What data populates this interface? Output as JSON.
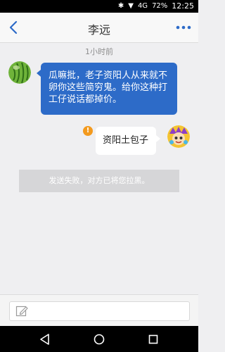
{
  "status_bar": {
    "network": "4G",
    "battery": "72%",
    "time": "12:25"
  },
  "header": {
    "title": "李远"
  },
  "chat": {
    "timestamp": "1小时前",
    "incoming_message": "瓜嘛批，老子资阳人从来就不卵你这些简穷鬼。给你这种打工仔说话都掉价。",
    "outgoing_message": "资阳土包子",
    "error_mark": "!",
    "system_notice": "发送失败，对方已将您拉黑。"
  },
  "colors": {
    "incoming_bubble": "#2d6bc8",
    "accent": "#2d6bc8",
    "error": "#f39a1e"
  }
}
